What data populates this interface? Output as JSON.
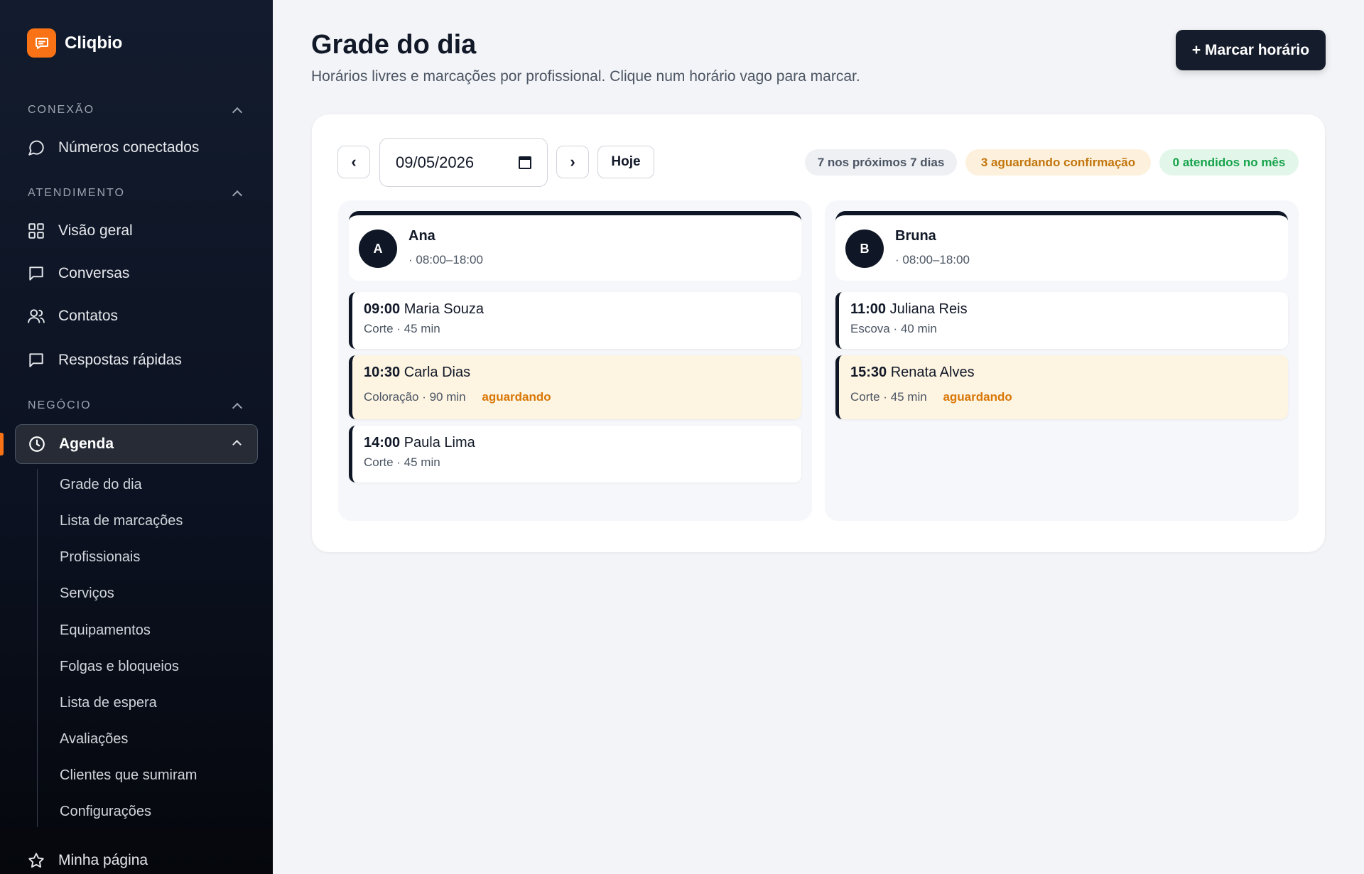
{
  "app": {
    "name": "Cliqbio"
  },
  "sidebar": {
    "sections": [
      {
        "label": "CONEXÃO"
      },
      {
        "label": "ATENDIMENTO"
      },
      {
        "label": "NEGÓCIO"
      }
    ],
    "items": {
      "numeros": "Números conectados",
      "visao": "Visão geral",
      "conversas": "Conversas",
      "contatos": "Contatos",
      "respostas": "Respostas rápidas",
      "agenda": "Agenda",
      "minha_pagina": "Minha página"
    },
    "agenda_sub": [
      "Grade do dia",
      "Lista de marcações",
      "Profissionais",
      "Serviços",
      "Equipamentos",
      "Folgas e bloqueios",
      "Lista de espera",
      "Avaliações",
      "Clientes que sumiram",
      "Configurações"
    ],
    "accent_color": "#f97316"
  },
  "header": {
    "title": "Grade do dia",
    "subtitle": "Horários livres e marcações por profissional. Clique num horário vago para marcar.",
    "primary_button": "+ Marcar horário"
  },
  "toolbar": {
    "prev": "‹",
    "next": "›",
    "date_value": "09/05/2026",
    "today": "Hoje",
    "stats": {
      "next7": "7 nos próximos 7 dias",
      "pending": "3 aguardando confirmação",
      "attended": "0 atendidos no mês"
    }
  },
  "professionals": [
    {
      "initial": "A",
      "name": "Ana",
      "hours": "· 08:00–18:00",
      "appointments": [
        {
          "time": "09:00",
          "client": "Maria Souza",
          "meta": "Corte · 45 min",
          "status": ""
        },
        {
          "time": "10:30",
          "client": "Carla Dias",
          "meta": "Coloração · 90 min",
          "status": "aguardando"
        },
        {
          "time": "14:00",
          "client": "Paula Lima",
          "meta": "Corte · 45 min",
          "status": ""
        }
      ]
    },
    {
      "initial": "B",
      "name": "Bruna",
      "hours": "· 08:00–18:00",
      "appointments": [
        {
          "time": "11:00",
          "client": "Juliana Reis",
          "meta": "Escova · 40 min",
          "status": ""
        },
        {
          "time": "15:30",
          "client": "Renata Alves",
          "meta": "Corte · 45 min",
          "status": "aguardando"
        }
      ]
    }
  ]
}
